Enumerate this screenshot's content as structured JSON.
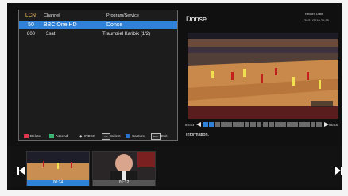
{
  "list": {
    "header": {
      "lcn": "LCN",
      "channel": "Channel",
      "program": "Program/Service"
    },
    "rows": [
      {
        "lcn": "50",
        "channel": "BBC One HD",
        "program": "Donse",
        "selected": true
      },
      {
        "lcn": "800",
        "channel": "3sat",
        "program": "Traumziel Karibik (1/2)",
        "selected": false
      }
    ],
    "legend": {
      "delete": "Delete",
      "ascend": "Ascend",
      "index_glyph": "◆",
      "index": "INDEX",
      "ok_key": "OK",
      "select": "Select",
      "capture": "Capture",
      "exit_key": "EXIT",
      "exit": "Exit"
    }
  },
  "preview": {
    "title": "Donse",
    "record_label": "Record Date",
    "record_date": "28/11/2019 21:35",
    "time_start": "00:34",
    "time_end": "05:56",
    "progress_fraction": 0.1,
    "info": "Information."
  },
  "thumbnails": [
    {
      "label": "00:34",
      "selected": true
    },
    {
      "label": "01:12",
      "selected": false
    }
  ],
  "colors": {
    "selection": "#2f82d7",
    "lcn_header": "#f2c15a",
    "legend_red": "#e0384a",
    "legend_green": "#3cb371",
    "legend_blue": "#2f6fd0"
  },
  "icons": {
    "prev": "skip-back-icon",
    "next": "skip-forward-icon",
    "rewind": "rewind-icon",
    "forward": "play-forward-icon"
  }
}
